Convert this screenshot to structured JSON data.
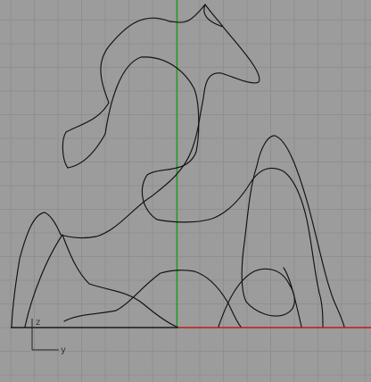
{
  "viewport": {
    "background": "#9c9c9c",
    "grid_color": "#8f8f8f",
    "x_axis_color": "#c21b1b",
    "y_axis_color": "#1f9e1f",
    "curve_color": "#111111"
  },
  "triad": {
    "vertical_label": "z",
    "horizontal_label": "y"
  }
}
